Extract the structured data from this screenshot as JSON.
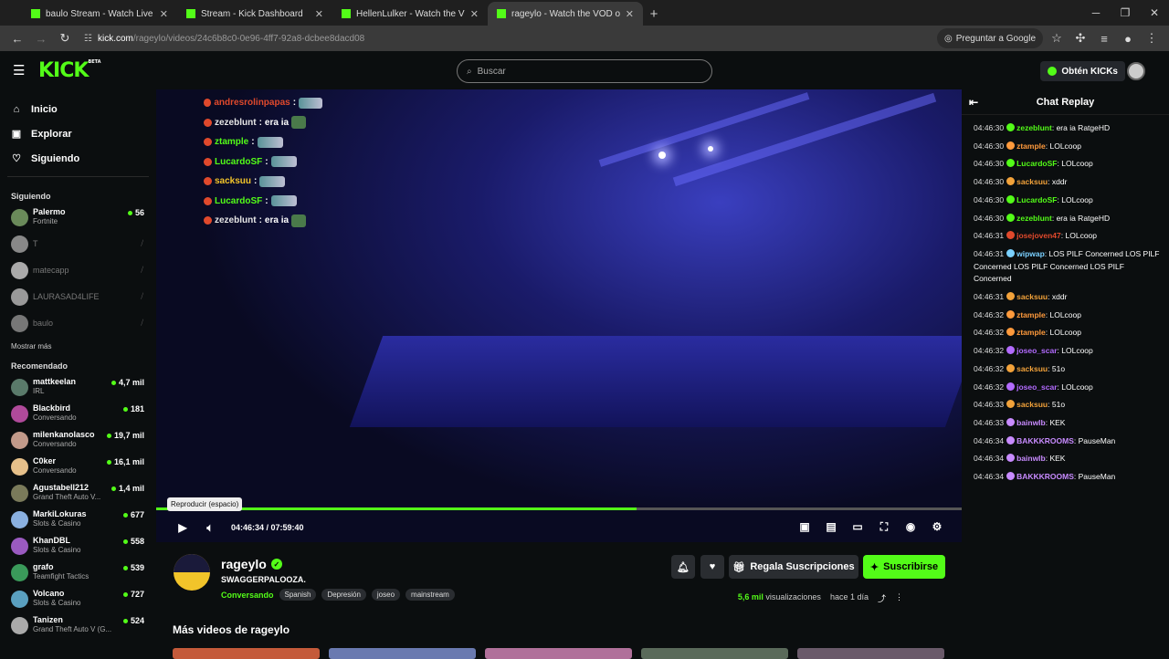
{
  "browser": {
    "tabs": [
      {
        "title": "baulo Stream - Watch Live on Kick",
        "active": false
      },
      {
        "title": "Stream - Kick Dashboard",
        "active": false
      },
      {
        "title": "HellenLulker - Watch the VOD on Kick",
        "active": false
      },
      {
        "title": "rageylo - Watch the VOD on Kick",
        "active": true
      }
    ],
    "url_host": "kick.com",
    "url_path": "/rageylo/videos/24c6b8c0-0e96-4ff7-92a8-dcbee8dacd08",
    "ask_google": "Preguntar a Google"
  },
  "header": {
    "logo": "KICK",
    "beta": "BETA",
    "search_placeholder": "Buscar",
    "kicks_label": "Obtén KICKs"
  },
  "sidebar": {
    "nav": [
      {
        "label": "Inicio",
        "icon": "home-icon"
      },
      {
        "label": "Explorar",
        "icon": "compass-icon"
      },
      {
        "label": "Siguiendo",
        "icon": "heart-icon"
      }
    ],
    "following_title": "Siguiendo",
    "following": [
      {
        "name": "Palermo",
        "category": "Fortnite",
        "viewers": "56",
        "live": true,
        "color": "#6a8a5a"
      },
      {
        "name": "T",
        "category": "",
        "live": false,
        "color": "#888"
      },
      {
        "name": "matecapp",
        "category": "",
        "live": false,
        "color": "#aaa"
      },
      {
        "name": "LAURASAD4LIFE",
        "category": "",
        "live": false,
        "color": "#999"
      },
      {
        "name": "baulo",
        "category": "",
        "live": false,
        "color": "#777"
      }
    ],
    "show_more": "Mostrar más",
    "recommended_title": "Recomendado",
    "recommended": [
      {
        "name": "mattkeelan",
        "category": "IRL",
        "viewers": "4,7 mil",
        "color": "#5a7a6a"
      },
      {
        "name": "Blackbird",
        "category": "Conversando",
        "viewers": "181",
        "color": "#b04a9a"
      },
      {
        "name": "milenkanolasco",
        "category": "Conversando",
        "viewers": "19,7 mil",
        "color": "#c29a8a"
      },
      {
        "name": "C0ker",
        "category": "Conversando",
        "viewers": "16,1 mil",
        "color": "#e6c08a"
      },
      {
        "name": "Agustabell212",
        "category": "Grand Theft Auto V...",
        "viewers": "1,4 mil",
        "color": "#7a7a5a"
      },
      {
        "name": "MarkiLokuras",
        "category": "Slots & Casino",
        "viewers": "677",
        "color": "#8ab0e0"
      },
      {
        "name": "KhanDBL",
        "category": "Slots & Casino",
        "viewers": "558",
        "color": "#9a5ac0"
      },
      {
        "name": "grafo",
        "category": "Teamfight Tactics",
        "viewers": "539",
        "color": "#3a9a5a"
      },
      {
        "name": "Volcano",
        "category": "Slots & Casino",
        "viewers": "727",
        "color": "#5aa0c0"
      },
      {
        "name": "Tanizen",
        "category": "Grand Theft Auto V (G...",
        "viewers": "524",
        "color": "#aaa"
      }
    ]
  },
  "player": {
    "overlay_chat": [
      {
        "user": "andresrolinpapas",
        "msg": "",
        "color": "#e0492c"
      },
      {
        "user": "zezeblunt",
        "msg": "era ia",
        "color": "#e6e6e6"
      },
      {
        "user": "ztample",
        "msg": "",
        "color": "#53fc18"
      },
      {
        "user": "LucardoSF",
        "msg": "",
        "color": "#53fc18"
      },
      {
        "user": "sacksuu",
        "msg": "",
        "color": "#f2c42a"
      },
      {
        "user": "LucardoSF",
        "msg": "",
        "color": "#53fc18"
      },
      {
        "user": "zezeblunt",
        "msg": "era ia",
        "color": "#e6e6e6"
      }
    ],
    "tooltip": "Reproducir (espacio)",
    "time": "04:46:34 / 07:59:40",
    "progress": 0.596
  },
  "channel": {
    "name": "rageylo",
    "title": "SWAGGERPALOOZA.",
    "category": "Conversando",
    "tags": [
      "Spanish",
      "Depresión",
      "joseo",
      "mainstream"
    ],
    "gift_label": "Regala Suscripciones",
    "subscribe_label": "Suscribirse",
    "views": "5,6 mil",
    "views_label": "visualizaciones",
    "ago": "hace 1 día"
  },
  "more_videos": "Más videos de rageylo",
  "chat": {
    "title": "Chat Replay",
    "messages": [
      {
        "t": "04:46:30",
        "u": "zezeblunt",
        "c": "#53fc18",
        "m": "era ia RatgeHD"
      },
      {
        "t": "04:46:30",
        "u": "ztample",
        "c": "#ff9a3c",
        "m": "LOLcoop"
      },
      {
        "t": "04:46:30",
        "u": "LucardoSF",
        "c": "#53fc18",
        "m": "LOLcoop"
      },
      {
        "t": "04:46:30",
        "u": "sacksuu",
        "c": "#f2a23a",
        "m": "xddr"
      },
      {
        "t": "04:46:30",
        "u": "LucardoSF",
        "c": "#53fc18",
        "m": "LOLcoop"
      },
      {
        "t": "04:46:30",
        "u": "zezeblunt",
        "c": "#53fc18",
        "m": "era ia RatgeHD"
      },
      {
        "t": "04:46:31",
        "u": "josejoven47",
        "c": "#e0492c",
        "m": "LOLcoop"
      },
      {
        "t": "04:46:31",
        "u": "wipwap",
        "c": "#7ad0ff",
        "m": "LOS PILF Concerned LOS PILF Concerned LOS PILF Concerned LOS PILF Concerned"
      },
      {
        "t": "04:46:31",
        "u": "sacksuu",
        "c": "#f2a23a",
        "m": "xddr"
      },
      {
        "t": "04:46:32",
        "u": "ztample",
        "c": "#ff9a3c",
        "m": "LOLcoop"
      },
      {
        "t": "04:46:32",
        "u": "ztample",
        "c": "#ff9a3c",
        "m": "LOLcoop"
      },
      {
        "t": "04:46:32",
        "u": "joseo_scar",
        "c": "#b36bff",
        "m": "LOLcoop"
      },
      {
        "t": "04:46:32",
        "u": "sacksuu",
        "c": "#f2a23a",
        "m": "51o"
      },
      {
        "t": "04:46:32",
        "u": "joseo_scar",
        "c": "#b36bff",
        "m": "LOLcoop"
      },
      {
        "t": "04:46:33",
        "u": "sacksuu",
        "c": "#f2a23a",
        "m": "51o"
      },
      {
        "t": "04:46:33",
        "u": "bainwlb",
        "c": "#c88bff",
        "m": "KEK"
      },
      {
        "t": "04:46:34",
        "u": "BAKKKROOMS",
        "c": "#c88bff",
        "m": "PauseMan"
      },
      {
        "t": "04:46:34",
        "u": "bainwlb",
        "c": "#c88bff",
        "m": "KEK"
      },
      {
        "t": "04:46:34",
        "u": "BAKKKROOMS",
        "c": "#c88bff",
        "m": "PauseMan"
      }
    ]
  },
  "colors": {
    "accent": "#53fc18",
    "background": "#0b0e0f"
  }
}
